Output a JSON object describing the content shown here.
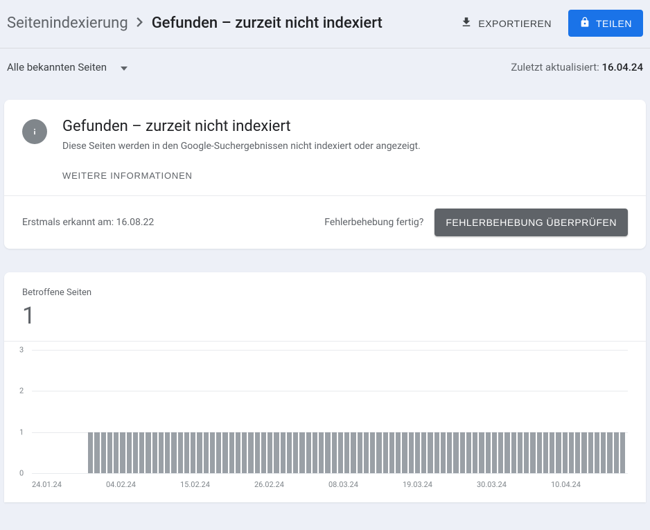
{
  "breadcrumb": {
    "parent": "Seitenindexierung",
    "current": "Gefunden – zurzeit nicht indexiert"
  },
  "header": {
    "export_label": "EXPORTIEREN",
    "share_label": "TEILEN"
  },
  "filter": {
    "label": "Alle bekannten Seiten"
  },
  "updated": {
    "prefix": "Zuletzt aktualisiert: ",
    "date": "16.04.24"
  },
  "info_card": {
    "title": "Gefunden – zurzeit nicht indexiert",
    "description": "Diese Seiten werden in den Google-Suchergebnissen nicht indexiert oder angezeigt.",
    "learn_more": "WEITERE INFORMATIONEN",
    "first_detected_prefix": "Erstmals erkannt am: ",
    "first_detected_date": "16.08.22",
    "fix_done_question": "Fehlerbehebung fertig?",
    "validate_label": "FEHLERBEHEBUNG ÜBERPRÜFEN"
  },
  "chart": {
    "label": "Betroffene Seiten",
    "value": "1"
  },
  "chart_data": {
    "type": "bar",
    "title": "Betroffene Seiten",
    "ylabel": "",
    "xlabel": "",
    "ylim": [
      0,
      3
    ],
    "y_ticks": [
      0,
      1,
      2,
      3
    ],
    "x_ticks": [
      "24.01.24",
      "04.02.24",
      "15.02.24",
      "26.02.24",
      "08.03.24",
      "19.03.24",
      "30.03.24",
      "10.04.24"
    ],
    "values": [
      0,
      0,
      0,
      0,
      1,
      1,
      1,
      1,
      1,
      1,
      1,
      1,
      1,
      1,
      1,
      1,
      1,
      1,
      1,
      1,
      1,
      1,
      1,
      1,
      1,
      1,
      1,
      1,
      1,
      1,
      1,
      1,
      1,
      1,
      1,
      1,
      1,
      1,
      1,
      1,
      1,
      1,
      1,
      1,
      1,
      1,
      1,
      1,
      1,
      1,
      1,
      1,
      1,
      1,
      1,
      1,
      1,
      1,
      1,
      1,
      1,
      1,
      1,
      1,
      1,
      1,
      1,
      1,
      1,
      1,
      1,
      1,
      1,
      1,
      1,
      1,
      1,
      1,
      1,
      1,
      1,
      1,
      1,
      1,
      1,
      1,
      1,
      1
    ]
  }
}
